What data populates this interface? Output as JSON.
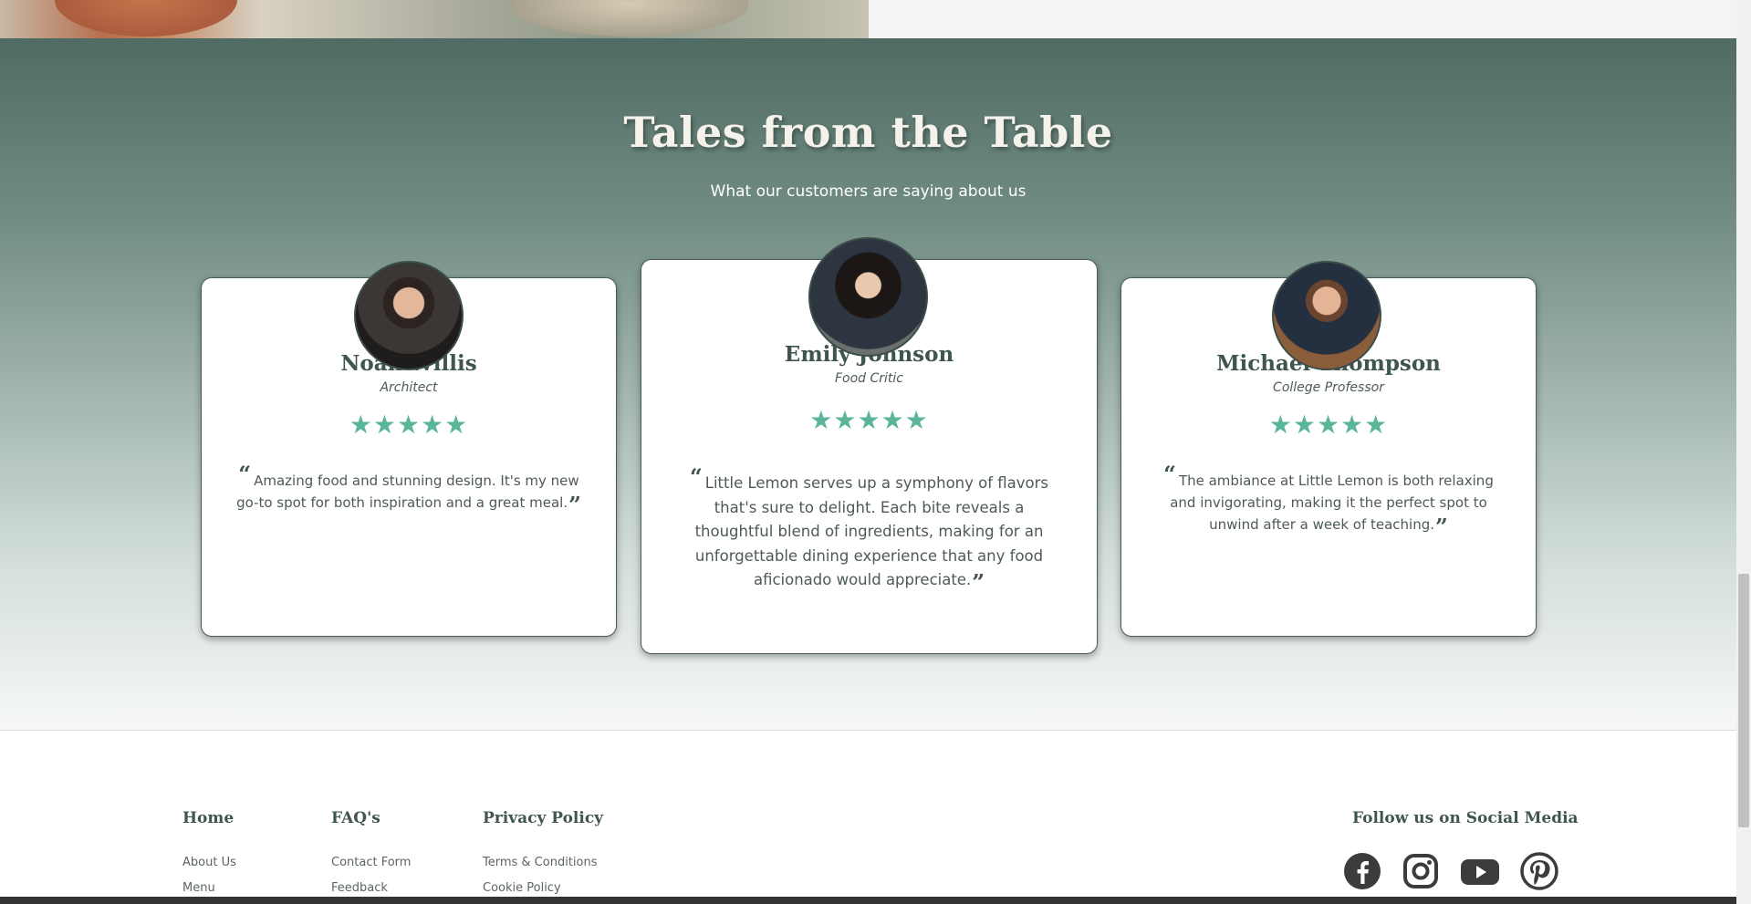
{
  "testimonials": {
    "title": "Tales from the Table",
    "subtitle": "What our customers are saying about us",
    "cards": [
      {
        "name": "Noah Willis",
        "role": "Architect",
        "rating": 5,
        "stars": "★★★★★",
        "quote": "Amazing food and stunning design. It's my new go-to spot for both inspiration and a great meal."
      },
      {
        "name": "Emily Johnson",
        "role": "Food Critic",
        "rating": 5,
        "stars": "★★★★★",
        "quote": "Little Lemon serves up a symphony of flavors that's sure to delight. Each bite reveals a thoughtful blend of ingredients, making for an unforgettable dining experience that any food aficionado would appreciate."
      },
      {
        "name": "Michael Thompson",
        "role": "College Professor",
        "rating": 5,
        "stars": "★★★★★",
        "quote": "The ambiance at Little Lemon is both relaxing and invigorating, making it the perfect spot to unwind after a week of teaching."
      }
    ],
    "open_quote": "“",
    "close_quote": "”"
  },
  "footer": {
    "columns": [
      {
        "heading": "Home",
        "links": [
          "About Us",
          "Menu"
        ]
      },
      {
        "heading": "FAQ's",
        "links": [
          "Contact Form",
          "Feedback"
        ]
      },
      {
        "heading": "Privacy Policy",
        "links": [
          "Terms & Conditions",
          "Cookie Policy"
        ]
      }
    ],
    "social": {
      "heading": "Follow us on Social Media",
      "icons": [
        "facebook-icon",
        "instagram-icon",
        "youtube-icon",
        "pinterest-icon"
      ]
    }
  },
  "colors": {
    "accent_green": "#5ab59a",
    "dark_green": "#3f5550",
    "section_top": "#4f6b63"
  }
}
